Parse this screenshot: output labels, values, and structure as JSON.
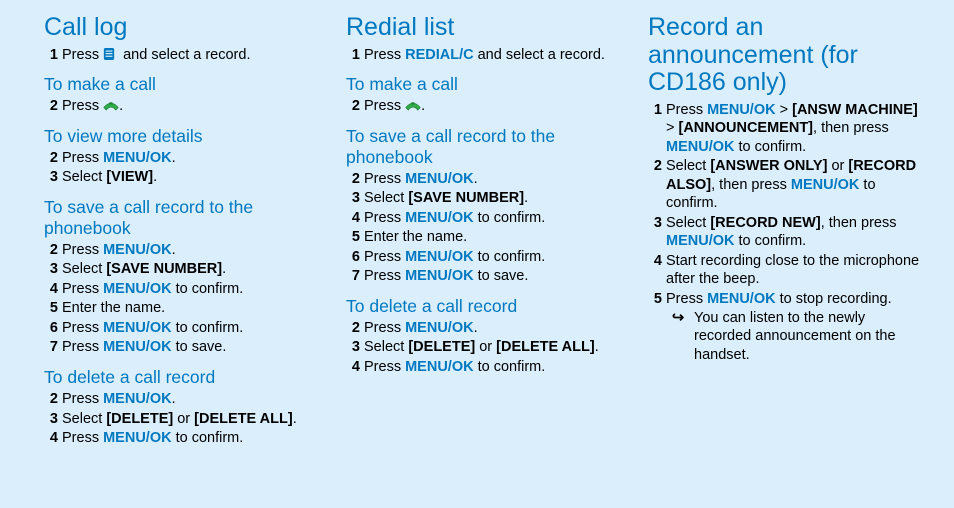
{
  "col1": {
    "title": "Call log",
    "s0": "Press {ICON:menu} and select a record.",
    "sub1": "To make a call",
    "s1_2": "Press {ICON:call}.",
    "sub2": "To view more details",
    "s2_2": "Press {BLUE:MENU/OK}.",
    "s2_3": "Select {B:[VIEW]}.",
    "sub3": "To save a call record to the phonebook",
    "s3_2": "Press {BLUE:MENU/OK}.",
    "s3_3": "Select {B:[SAVE NUMBER]}.",
    "s3_4": "Press {BLUE:MENU/OK} to confirm.",
    "s3_5": "Enter the name.",
    "s3_6": "Press {BLUE:MENU/OK} to confirm.",
    "s3_7": "Press {BLUE:MENU/OK} to save.",
    "sub4": "To delete a call record",
    "s4_2": "Press {BLUE:MENU/OK}.",
    "s4_3": "Select {B:[DELETE]} or {B:[DELETE ALL]}.",
    "s4_4": "Press {BLUE:MENU/OK} to confirm."
  },
  "col2": {
    "title": "Redial list",
    "s0": "Press {BLUE:REDIAL/C} and select a record.",
    "sub1": "To make a call",
    "s1_2": "Press {ICON:call}.",
    "sub2": "To save a call record to the phonebook",
    "s2_2": "Press {BLUE:MENU/OK}.",
    "s2_3": "Select {B:[SAVE NUMBER]}.",
    "s2_4": "Press {BLUE:MENU/OK} to confirm.",
    "s2_5": "Enter the name.",
    "s2_6": "Press {BLUE:MENU/OK} to confirm.",
    "s2_7": "Press {BLUE:MENU/OK} to save.",
    "sub3": "To delete a call record",
    "s3_2": "Press {BLUE:MENU/OK}.",
    "s3_3": "Select {B:[DELETE]} or {B:[DELETE ALL]}.",
    "s3_4": "Press {BLUE:MENU/OK} to confirm."
  },
  "col3": {
    "title": "Record an announcement (for CD186 only)",
    "s1": "Press {BLUE:MENU/OK} > {B:[ANSW MACHINE]} > {B:[ANNOUNCEMENT]}, then press {BLUE:MENU/OK} to confirm.",
    "s2": "Select {B:[ANSWER ONLY]} or {B:[RECORD ALSO]}, then press {BLUE:MENU/OK} to confirm.",
    "s3": "Select {B:[RECORD NEW]}, then press {BLUE:MENU/OK} to confirm.",
    "s4": "Start recording close to the microphone after the beep.",
    "s5": "Press {BLUE:MENU/OK} to stop recording.",
    "tip": "You can listen to the newly recorded announcement on the handset."
  }
}
